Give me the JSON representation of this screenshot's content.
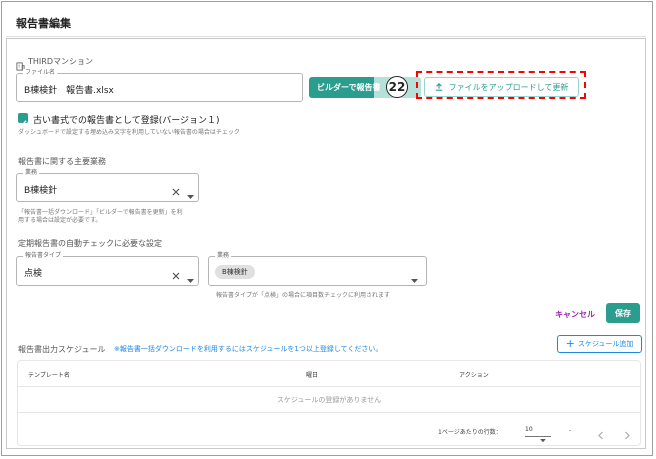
{
  "header": {
    "title": "報告書編集"
  },
  "building": {
    "name": "THIRDマンション",
    "icon": "building-icon"
  },
  "file": {
    "label": "ファイル名",
    "value": "B棟検針　報告書.xlsx",
    "builder_button": "ビルダーで報告書",
    "badge": "22",
    "upload_button": "ファイルをアップロードして更新",
    "upload_icon": "upload-icon"
  },
  "old_format": {
    "checked": true,
    "label": "古い書式での報告書として登録(バージョン１)",
    "help": "ダッシュボードで設定する埋め込み文字を利用していない報告書の場合はチェック"
  },
  "main_work": {
    "section_title": "報告書に関する主要業務",
    "field_label": "業務",
    "value": "B棟検針",
    "help_line1": "「報告書一括ダウンロード」「ビルダーで報告書を更新」を利",
    "help_line2": "用する場合は設定が必要です。"
  },
  "auto_check": {
    "section_title": "定期報告書の自動チェックに必要な設定",
    "type_label": "報告書タイプ",
    "type_value": "点検",
    "work_label": "業務",
    "work_chip": "B棟検針",
    "help": "報告書タイプが「点検」の場合に項目数チェックに利用されます"
  },
  "actions": {
    "cancel": "キャンセル",
    "save": "保存"
  },
  "schedule": {
    "title": "報告書出力スケジュール",
    "note": "※報告書一括ダウンロードを利用するにはスケジュールを1つ以上登録してください。",
    "add_button": "スケジュール追加",
    "columns": [
      "テンプレート名",
      "曜日",
      "アクション"
    ],
    "empty": "スケジュールの登録がありません",
    "rows_per_page_label": "1ページあたりの行数：",
    "rows_per_page": "10",
    "range": "-"
  },
  "colors": {
    "accent": "#2a9d8f",
    "accent_light": "#b6e0da",
    "link": "#1e88e5",
    "cancel": "#9c27b0",
    "highlight": "#ff0000"
  }
}
